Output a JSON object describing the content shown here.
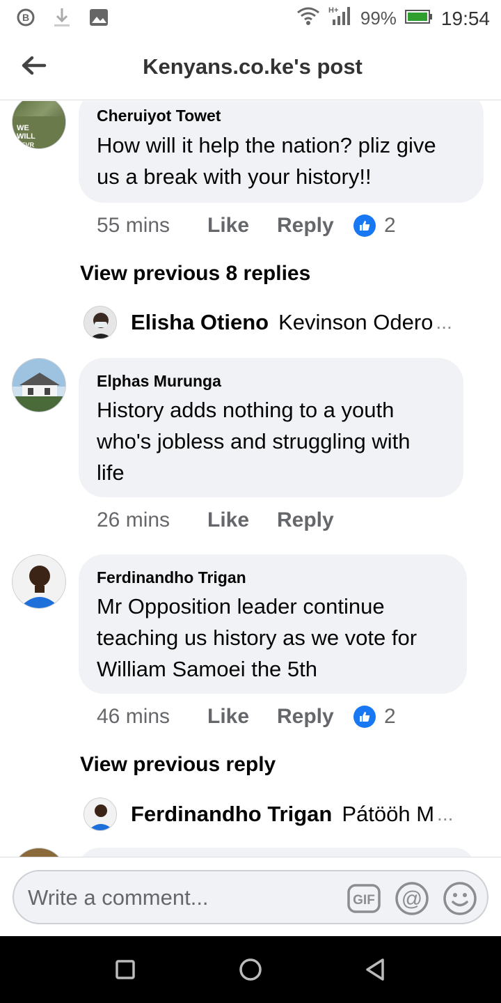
{
  "status_bar": {
    "battery_percent": "99%",
    "time": "19:54",
    "network": "H+",
    "icons": [
      "b-icon",
      "download-icon",
      "image-icon",
      "wifi-icon",
      "signal-icon",
      "battery-icon"
    ]
  },
  "header": {
    "title": "Kenyans.co.ke's post",
    "back_icon": "arrow-left-icon"
  },
  "comments": [
    {
      "author": "Cheruiyot Towet",
      "text_lines": [
        "How will it help the nation? pliz give",
        "us a break with your history!!"
      ],
      "time": "55 mins",
      "like_label": "Like",
      "reply_label": "Reply",
      "reaction_count": "2",
      "view_previous": "View previous 8 replies",
      "reply_preview": {
        "author": "Elisha Otieno",
        "text": "Kevinson Odero",
        "ellipsis": "..."
      }
    },
    {
      "author": "Elphas Murunga",
      "text_lines": [
        "History adds nothing to a youth",
        "who's jobless and struggling with",
        "life"
      ],
      "time": "26 mins",
      "like_label": "Like",
      "reply_label": "Reply"
    },
    {
      "author": "Ferdinandho Trigan",
      "text_lines": [
        "Mr Opposition leader continue",
        "teaching us history as we vote for",
        "William Samoei the 5th"
      ],
      "time": "46 mins",
      "like_label": "Like",
      "reply_label": "Reply",
      "reaction_count": "2",
      "view_previous": "View previous reply",
      "reply_preview": {
        "author": "Ferdinandho Trigan",
        "text": "Pátööh M",
        "ellipsis": "..."
      }
    }
  ],
  "composer": {
    "placeholder": "Write a comment...",
    "icons": [
      "gif-icon",
      "at-mention-icon",
      "emoji-icon"
    ],
    "gif_label": "GIF"
  },
  "nav_bar": {
    "icons": [
      "recents-square-icon",
      "home-circle-icon",
      "back-triangle-icon"
    ]
  },
  "colors": {
    "accent": "#1877f2",
    "bubble": "#f0f2f5",
    "secondary_text": "#65676b"
  }
}
